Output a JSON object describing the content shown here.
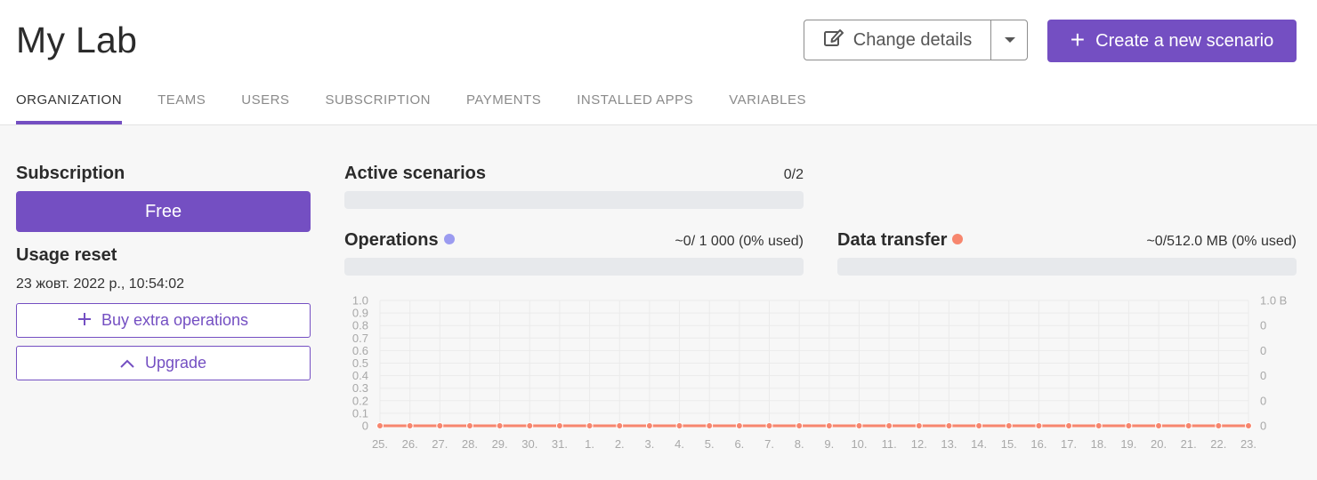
{
  "header": {
    "title": "My Lab",
    "change_details_label": "Change details",
    "create_label": "Create a new scenario"
  },
  "tabs": [
    {
      "label": "ORGANIZATION",
      "active": true
    },
    {
      "label": "TEAMS"
    },
    {
      "label": "USERS"
    },
    {
      "label": "SUBSCRIPTION"
    },
    {
      "label": "PAYMENTS"
    },
    {
      "label": "INSTALLED APPS"
    },
    {
      "label": "VARIABLES"
    }
  ],
  "subscription": {
    "heading": "Subscription",
    "plan": "Free",
    "usage_reset_heading": "Usage reset",
    "usage_reset_date": "23 жовт. 2022 р., 10:54:02",
    "buy_extra_label": "Buy extra operations",
    "upgrade_label": "Upgrade"
  },
  "usage": {
    "active_scenarios_label": "Active scenarios",
    "active_scenarios_count": "0/2",
    "active_scenarios_fraction": 0,
    "operations_label": "Operations",
    "operations_count": "~0/ 1 000 (0% used)",
    "operations_fraction": 0,
    "data_transfer_label": "Data transfer",
    "data_transfer_count": "~0/512.0 MB (0% used)",
    "data_transfer_fraction": 0
  },
  "colors": {
    "accent": "#744fc2",
    "operations": "#9b9bf0",
    "data_transfer": "#f7866e"
  },
  "chart_data": {
    "type": "line",
    "x": [
      "25.",
      "26.",
      "27.",
      "28.",
      "29.",
      "30.",
      "31.",
      "1.",
      "2.",
      "3.",
      "4.",
      "5.",
      "6.",
      "7.",
      "8.",
      "9.",
      "10.",
      "11.",
      "12.",
      "13.",
      "14.",
      "15.",
      "16.",
      "17.",
      "18.",
      "19.",
      "20.",
      "21.",
      "22.",
      "23."
    ],
    "left_ylim": [
      0,
      1.0
    ],
    "left_ticks": [
      "0",
      "0.1",
      "0.2",
      "0.3",
      "0.4",
      "0.5",
      "0.6",
      "0.7",
      "0.8",
      "0.9",
      "1.0"
    ],
    "right_ticks": [
      "0",
      "0",
      "0",
      "0",
      "0",
      "1.0 B"
    ],
    "series": [
      {
        "axis": "left",
        "color": "#9b9bf0",
        "values": [
          0,
          0,
          0,
          0,
          0,
          0,
          0,
          0,
          0,
          0,
          0,
          0,
          0,
          0,
          0,
          0,
          0,
          0,
          0,
          0,
          0,
          0,
          0,
          0,
          0,
          0,
          0,
          0,
          0,
          0
        ]
      },
      {
        "axis": "right",
        "color": "#f7866e",
        "values": [
          0,
          0,
          0,
          0,
          0,
          0,
          0,
          0,
          0,
          0,
          0,
          0,
          0,
          0,
          0,
          0,
          0,
          0,
          0,
          0,
          0,
          0,
          0,
          0,
          0,
          0,
          0,
          0,
          0,
          0
        ]
      }
    ],
    "grid": true
  }
}
